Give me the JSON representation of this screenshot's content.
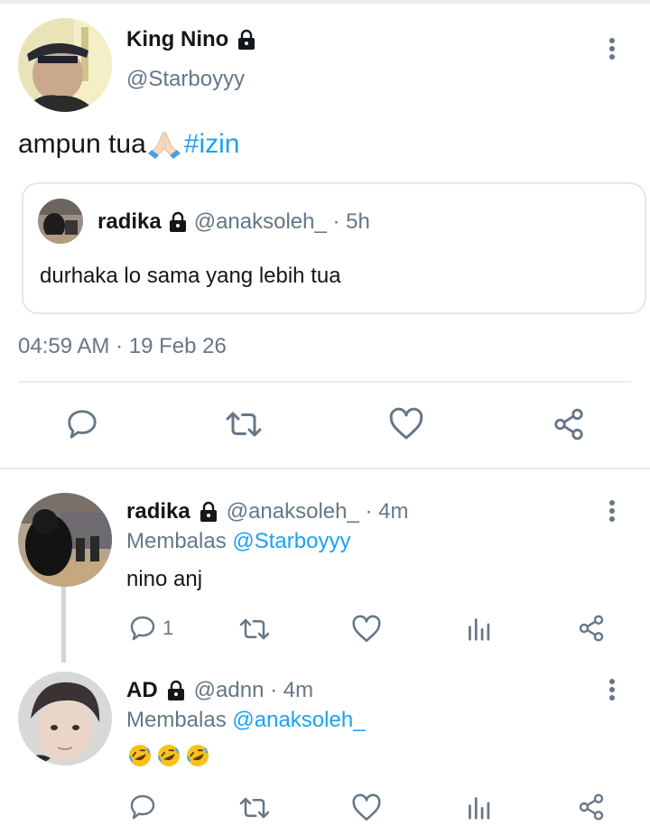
{
  "main_tweet": {
    "display_name": "King Nino",
    "handle": "@Starboyyy",
    "text_plain": "ampun tua",
    "hashtag": "#izin",
    "timestamp": "04:59 AM · 19 Feb 26",
    "quoted": {
      "display_name": "radika",
      "handle_time": "@anaksoleh_ · 5h",
      "text": "durhaka lo sama yang lebih tua"
    }
  },
  "replies": [
    {
      "display_name": "radika",
      "handle_time": "@anaksoleh_ · 4m",
      "replying_prefix": "Membalas",
      "replying_to": "@Starboyyy",
      "text": "nino anj",
      "reply_count": "1"
    },
    {
      "display_name": "AD",
      "handle_time": "@adnn · 4m",
      "replying_prefix": "Membalas",
      "replying_to": "@anaksoleh_",
      "text": "🤣🤣🤣",
      "reply_count": ""
    }
  ],
  "icons": {
    "lock": "lock-icon",
    "more": "more-vertical-icon",
    "reply": "reply-bubble-icon",
    "retweet": "retweet-icon",
    "like": "heart-icon",
    "share": "share-icon",
    "analytics": "analytics-icon",
    "pray": "folded-hands-emoji",
    "laugh": "rofl-emoji"
  },
  "colors": {
    "accent": "#1da1f2",
    "secondary_text": "#657786",
    "primary_text": "#14171a",
    "divider": "#e6ecf0"
  }
}
